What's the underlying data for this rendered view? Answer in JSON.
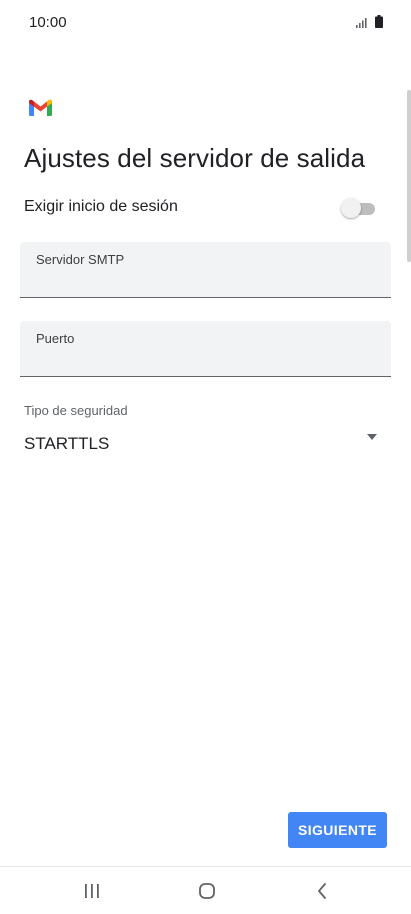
{
  "status_bar": {
    "time": "10:00",
    "icons": [
      "signal-icon",
      "battery-icon"
    ]
  },
  "app": {
    "logo_icon": "gmail-logo-icon",
    "colors": {
      "gmail_red": "#ea4335",
      "gmail_blue": "#4285f4",
      "gmail_green": "#34a853",
      "gmail_yellow": "#fbbc04",
      "accent": "#4285f4"
    }
  },
  "header": {
    "title": "Ajustes del servidor de salida"
  },
  "settings": {
    "require_login_label": "Exigir inicio de sesión",
    "require_login_enabled": false
  },
  "fields": {
    "smtp_server": {
      "label": "Servidor SMTP",
      "value": ""
    },
    "port": {
      "label": "Puerto",
      "value": ""
    }
  },
  "security": {
    "label": "Tipo de seguridad",
    "selected": "STARTTLS"
  },
  "actions": {
    "next_label": "SIGUIENTE"
  },
  "nav_bar": {
    "icons": [
      "recent-apps-icon",
      "home-icon",
      "back-icon"
    ]
  }
}
